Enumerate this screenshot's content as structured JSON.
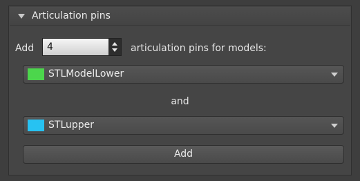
{
  "panel": {
    "title": "Articulation pins"
  },
  "add_row": {
    "prefix": "Add",
    "count": "4",
    "suffix": "articulation pins for models:"
  },
  "model_a": {
    "label": "STLModelLower",
    "color": "#4cd64c"
  },
  "connector": "and",
  "model_b": {
    "label": "STLupper",
    "color": "#27c2f2"
  },
  "add_button_label": "Add",
  "icons": {
    "collapse": "triangle-down-icon",
    "spin_up": "arrow-up-icon",
    "spin_down": "arrow-down-icon",
    "dropdown": "chevron-down-icon"
  }
}
